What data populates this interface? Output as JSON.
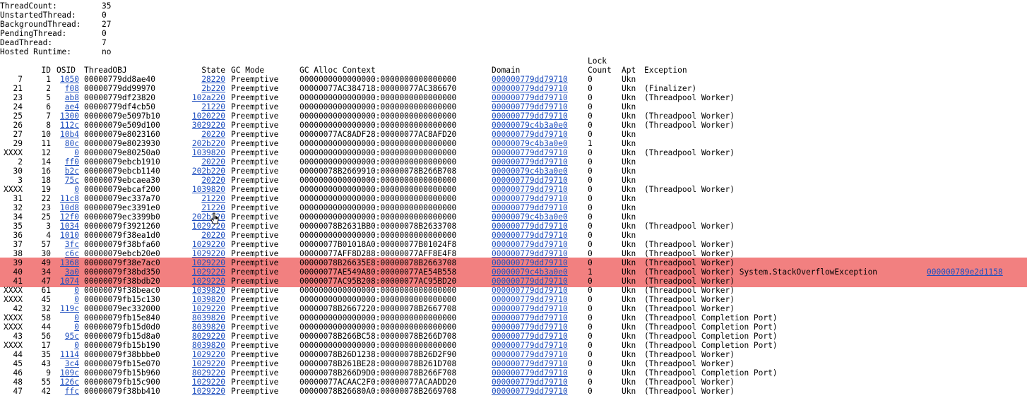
{
  "summary": [
    {
      "label": "ThreadCount:",
      "value": "35"
    },
    {
      "label": "UnstartedThread:",
      "value": "0"
    },
    {
      "label": "BackgroundThread:",
      "value": "27"
    },
    {
      "label": "PendingThread:",
      "value": "0"
    },
    {
      "label": "DeadThread:",
      "value": "7"
    },
    {
      "label": "Hosted Runtime:",
      "value": "no"
    }
  ],
  "headers": {
    "lock": "Lock",
    "id": "ID",
    "osid": "OSID",
    "threadobj": "ThreadOBJ",
    "state": "State",
    "gcmode": "GC Mode",
    "gcalloc": "GC Alloc Context",
    "domain": "Domain",
    "count": "Count",
    "apt": "Apt",
    "exception": "Exception"
  },
  "highlight_color": "#f28080",
  "link_color": "#1f4fbf",
  "rows": [
    {
      "dbg": "7",
      "id": "1",
      "osid": "1050",
      "obj": "00000779dd8ae40",
      "state": "28220",
      "gc": "Preemptive",
      "alloc": "0000000000000000:0000000000000000",
      "domain": "000000779dd79710",
      "lock": "0",
      "apt": "Ukn",
      "exc": ""
    },
    {
      "dbg": "21",
      "id": "2",
      "osid": "f08",
      "obj": "00000779dd99970",
      "state": "2b220",
      "gc": "Preemptive",
      "alloc": "00000077AC384718:00000077AC386670",
      "domain": "000000779dd79710",
      "lock": "0",
      "apt": "Ukn",
      "exc": "(Finalizer)"
    },
    {
      "dbg": "23",
      "id": "5",
      "osid": "ab8",
      "obj": "00000779df23820",
      "state": "102a220",
      "gc": "Preemptive",
      "alloc": "0000000000000000:0000000000000000",
      "domain": "000000779dd79710",
      "lock": "0",
      "apt": "Ukn",
      "exc": "(Threadpool Worker)"
    },
    {
      "dbg": "24",
      "id": "6",
      "osid": "ae4",
      "obj": "00000779df4cb50",
      "state": "21220",
      "gc": "Preemptive",
      "alloc": "0000000000000000:0000000000000000",
      "domain": "000000779dd79710",
      "lock": "0",
      "apt": "Ukn",
      "exc": ""
    },
    {
      "dbg": "25",
      "id": "7",
      "osid": "1300",
      "obj": "00000079e5097b10",
      "state": "1020220",
      "gc": "Preemptive",
      "alloc": "0000000000000000:0000000000000000",
      "domain": "000000779dd79710",
      "lock": "0",
      "apt": "Ukn",
      "exc": "(Threadpool Worker)"
    },
    {
      "dbg": "26",
      "id": "8",
      "osid": "112c",
      "obj": "00000079e509d100",
      "state": "3029220",
      "gc": "Preemptive",
      "alloc": "0000000000000000:0000000000000000",
      "domain": "00000079c4b3a0e0",
      "lock": "0",
      "apt": "Ukn",
      "exc": "(Threadpool Worker)"
    },
    {
      "dbg": "27",
      "id": "10",
      "osid": "10b4",
      "obj": "00000079e8023160",
      "state": "20220",
      "gc": "Preemptive",
      "alloc": "00000077AC8ADF28:00000077AC8AFD20",
      "domain": "000000779dd79710",
      "lock": "0",
      "apt": "Ukn",
      "exc": ""
    },
    {
      "dbg": "29",
      "id": "11",
      "osid": "80c",
      "obj": "00000079e8023930",
      "state": "202b220",
      "gc": "Preemptive",
      "alloc": "0000000000000000:0000000000000000",
      "domain": "00000079c4b3a0e0",
      "lock": "1",
      "apt": "Ukn",
      "exc": ""
    },
    {
      "dbg": "XXXX",
      "id": "12",
      "osid": "0",
      "obj": "00000079e80250a0",
      "state": "1039820",
      "gc": "Preemptive",
      "alloc": "0000000000000000:0000000000000000",
      "domain": "000000779dd79710",
      "lock": "0",
      "apt": "Ukn",
      "exc": "(Threadpool Worker)"
    },
    {
      "dbg": "2",
      "id": "14",
      "osid": "ff0",
      "obj": "00000079ebcb1910",
      "state": "20220",
      "gc": "Preemptive",
      "alloc": "0000000000000000:0000000000000000",
      "domain": "000000779dd79710",
      "lock": "0",
      "apt": "Ukn",
      "exc": ""
    },
    {
      "dbg": "30",
      "id": "16",
      "osid": "b2c",
      "obj": "00000079ebcb1140",
      "state": "202b220",
      "gc": "Preemptive",
      "alloc": "00000078B2669910:00000078B266B708",
      "domain": "00000079c4b3a0e0",
      "lock": "0",
      "apt": "Ukn",
      "exc": ""
    },
    {
      "dbg": "3",
      "id": "18",
      "osid": "75c",
      "obj": "00000079ebcaea30",
      "state": "20220",
      "gc": "Preemptive",
      "alloc": "0000000000000000:0000000000000000",
      "domain": "000000779dd79710",
      "lock": "0",
      "apt": "Ukn",
      "exc": ""
    },
    {
      "dbg": "XXXX",
      "id": "19",
      "osid": "0",
      "obj": "00000079ebcaf200",
      "state": "1039820",
      "gc": "Preemptive",
      "alloc": "0000000000000000:0000000000000000",
      "domain": "000000779dd79710",
      "lock": "0",
      "apt": "Ukn",
      "exc": "(Threadpool Worker)"
    },
    {
      "dbg": "31",
      "id": "22",
      "osid": "11c8",
      "obj": "00000079ec337a70",
      "state": "21220",
      "gc": "Preemptive",
      "alloc": "0000000000000000:0000000000000000",
      "domain": "000000779dd79710",
      "lock": "0",
      "apt": "Ukn",
      "exc": ""
    },
    {
      "dbg": "32",
      "id": "23",
      "osid": "10d8",
      "obj": "00000079ec3391e0",
      "state": "21220",
      "gc": "Preemptive",
      "alloc": "0000000000000000:0000000000000000",
      "domain": "000000779dd79710",
      "lock": "0",
      "apt": "Ukn",
      "exc": ""
    },
    {
      "dbg": "34",
      "id": "25",
      "osid": "12f0",
      "obj": "00000079ec3399b0",
      "state": "202b220",
      "gc": "Preemptive",
      "alloc": "0000000000000000:0000000000000000",
      "domain": "00000079c4b3a0e0",
      "lock": "0",
      "apt": "Ukn",
      "exc": ""
    },
    {
      "dbg": "35",
      "id": "3",
      "osid": "1034",
      "obj": "00000079f3921260",
      "state": "1029220",
      "gc": "Preemptive",
      "alloc": "00000078B2631BB0:00000078B2633708",
      "domain": "000000779dd79710",
      "lock": "0",
      "apt": "Ukn",
      "exc": "(Threadpool Worker)"
    },
    {
      "dbg": "36",
      "id": "4",
      "osid": "1010",
      "obj": "00000079f38ea1d0",
      "state": "20220",
      "gc": "Preemptive",
      "alloc": "0000000000000000:0000000000000000",
      "domain": "000000779dd79710",
      "lock": "0",
      "apt": "Ukn",
      "exc": ""
    },
    {
      "dbg": "37",
      "id": "57",
      "osid": "3fc",
      "obj": "00000079f38bfa60",
      "state": "1029220",
      "gc": "Preemptive",
      "alloc": "00000077B01018A0:00000077B01024F8",
      "domain": "000000779dd79710",
      "lock": "0",
      "apt": "Ukn",
      "exc": "(Threadpool Worker)"
    },
    {
      "dbg": "38",
      "id": "30",
      "osid": "c6c",
      "obj": "00000079ebcb20e0",
      "state": "1029220",
      "gc": "Preemptive",
      "alloc": "00000077AFF8D288:00000077AFF8E4F8",
      "domain": "000000779dd79710",
      "lock": "0",
      "apt": "Ukn",
      "exc": "(Threadpool Worker)"
    },
    {
      "dbg": "39",
      "id": "49",
      "osid": "1368",
      "obj": "00000079f38e7ac0",
      "state": "1029220",
      "gc": "Preemptive",
      "alloc": "00000078B26635E8:00000078B2663708",
      "domain": "000000779dd79710",
      "lock": "0",
      "apt": "Ukn",
      "exc": "(Threadpool Worker)",
      "hl": true
    },
    {
      "dbg": "40",
      "id": "34",
      "osid": "3a0",
      "obj": "00000079f38bd350",
      "state": "1029220",
      "gc": "Preemptive",
      "alloc": "00000077AE549A80:00000077AE54B558",
      "domain": "00000079c4b3a0e0",
      "lock": "1",
      "apt": "Ukn",
      "exc": "(Threadpool Worker) System.StackOverflowException",
      "excaddr": "000000789e2d1158",
      "hl": true
    },
    {
      "dbg": "41",
      "id": "47",
      "osid": "1074",
      "obj": "00000079f38bdb20",
      "state": "1029220",
      "gc": "Preemptive",
      "alloc": "00000077AC95B208:00000077AC95BD20",
      "domain": "000000779dd79710",
      "lock": "0",
      "apt": "Ukn",
      "exc": "(Threadpool Worker)",
      "hl": true
    },
    {
      "dbg": "XXXX",
      "id": "61",
      "osid": "0",
      "obj": "00000079f38beac0",
      "state": "1039820",
      "gc": "Preemptive",
      "alloc": "0000000000000000:0000000000000000",
      "domain": "000000779dd79710",
      "lock": "0",
      "apt": "Ukn",
      "exc": "(Threadpool Worker)"
    },
    {
      "dbg": "XXXX",
      "id": "45",
      "osid": "0",
      "obj": "00000079fb15c130",
      "state": "1039820",
      "gc": "Preemptive",
      "alloc": "0000000000000000:0000000000000000",
      "domain": "000000779dd79710",
      "lock": "0",
      "apt": "Ukn",
      "exc": "(Threadpool Worker)"
    },
    {
      "dbg": "42",
      "id": "32",
      "osid": "119c",
      "obj": "00000079ec332000",
      "state": "1029220",
      "gc": "Preemptive",
      "alloc": "00000078B2667220:00000078B2667708",
      "domain": "000000779dd79710",
      "lock": "0",
      "apt": "Ukn",
      "exc": "(Threadpool Worker)"
    },
    {
      "dbg": "XXXX",
      "id": "58",
      "osid": "0",
      "obj": "00000079fb15e840",
      "state": "8039820",
      "gc": "Preemptive",
      "alloc": "0000000000000000:0000000000000000",
      "domain": "000000779dd79710",
      "lock": "0",
      "apt": "Ukn",
      "exc": "(Threadpool Completion Port)"
    },
    {
      "dbg": "XXXX",
      "id": "44",
      "osid": "0",
      "obj": "00000079fb15d0d0",
      "state": "8039820",
      "gc": "Preemptive",
      "alloc": "0000000000000000:0000000000000000",
      "domain": "000000779dd79710",
      "lock": "0",
      "apt": "Ukn",
      "exc": "(Threadpool Completion Port)"
    },
    {
      "dbg": "43",
      "id": "56",
      "osid": "95c",
      "obj": "00000079fb15d8a0",
      "state": "8029220",
      "gc": "Preemptive",
      "alloc": "00000078B266BC58:00000078B266D708",
      "domain": "000000779dd79710",
      "lock": "0",
      "apt": "Ukn",
      "exc": "(Threadpool Completion Port)"
    },
    {
      "dbg": "XXXX",
      "id": "17",
      "osid": "0",
      "obj": "00000079fb15b190",
      "state": "8039820",
      "gc": "Preemptive",
      "alloc": "0000000000000000:0000000000000000",
      "domain": "000000779dd79710",
      "lock": "0",
      "apt": "Ukn",
      "exc": "(Threadpool Completion Port)"
    },
    {
      "dbg": "44",
      "id": "35",
      "osid": "1114",
      "obj": "00000079f38bbbe0",
      "state": "1029220",
      "gc": "Preemptive",
      "alloc": "00000078B26D1238:00000078B26D2F90",
      "domain": "000000779dd79710",
      "lock": "0",
      "apt": "Ukn",
      "exc": "(Threadpool Worker)"
    },
    {
      "dbg": "45",
      "id": "43",
      "osid": "3c4",
      "obj": "00000079fb15e070",
      "state": "1029220",
      "gc": "Preemptive",
      "alloc": "00000078B261BE28:00000078B261D708",
      "domain": "000000779dd79710",
      "lock": "0",
      "apt": "Ukn",
      "exc": "(Threadpool Worker)"
    },
    {
      "dbg": "46",
      "id": "9",
      "osid": "109c",
      "obj": "00000079fb15b960",
      "state": "8029220",
      "gc": "Preemptive",
      "alloc": "00000078B266D9D0:00000078B266F708",
      "domain": "000000779dd79710",
      "lock": "0",
      "apt": "Ukn",
      "exc": "(Threadpool Completion Port)"
    },
    {
      "dbg": "48",
      "id": "55",
      "osid": "126c",
      "obj": "00000079fb15c900",
      "state": "1029220",
      "gc": "Preemptive",
      "alloc": "00000077ACAAC2F0:00000077ACAADD20",
      "domain": "000000779dd79710",
      "lock": "0",
      "apt": "Ukn",
      "exc": "(Threadpool Worker)"
    },
    {
      "dbg": "47",
      "id": "42",
      "osid": "ffc",
      "obj": "00000079f38bb410",
      "state": "1029220",
      "gc": "Preemptive",
      "alloc": "00000078B26680A0:00000078B2669708",
      "domain": "000000779dd79710",
      "lock": "0",
      "apt": "Ukn",
      "exc": "(Threadpool Worker)"
    }
  ]
}
